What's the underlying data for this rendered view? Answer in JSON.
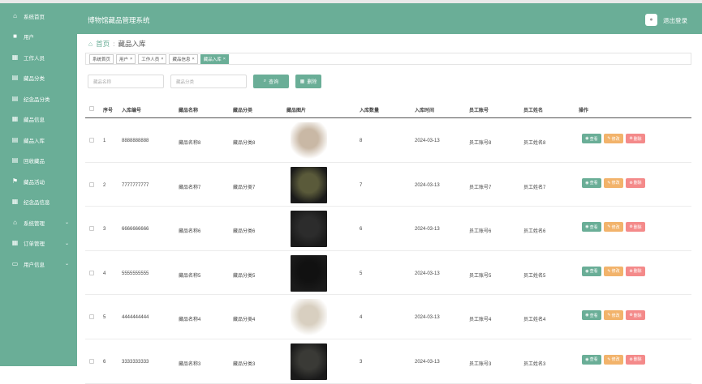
{
  "app": {
    "title": "博物馆藏品管理系统",
    "logout_label": "退出登录"
  },
  "sidebar": {
    "items": [
      {
        "label": "系统首页",
        "icon": "home-icon",
        "has_arrow": false
      },
      {
        "label": "用户",
        "icon": "user-square-icon",
        "has_arrow": false
      },
      {
        "label": "工作人员",
        "icon": "grid-icon",
        "has_arrow": false
      },
      {
        "label": "藏品分类",
        "icon": "clipboard-icon",
        "has_arrow": false
      },
      {
        "label": "纪念品分类",
        "icon": "clipboard-icon",
        "has_arrow": false
      },
      {
        "label": "藏品信息",
        "icon": "grid-icon",
        "has_arrow": false
      },
      {
        "label": "藏品入库",
        "icon": "clipboard-icon",
        "has_arrow": false
      },
      {
        "label": "回收藏品",
        "icon": "clipboard-icon",
        "has_arrow": false
      },
      {
        "label": "藏品活动",
        "icon": "flag-icon",
        "has_arrow": false
      },
      {
        "label": "纪念品信息",
        "icon": "table-icon",
        "has_arrow": false
      },
      {
        "label": "系统管理",
        "icon": "bank-icon",
        "has_arrow": true
      },
      {
        "label": "订单管理",
        "icon": "grid-icon",
        "has_arrow": true
      },
      {
        "label": "用户信息",
        "icon": "card-icon",
        "has_arrow": true
      }
    ]
  },
  "breadcrumb": {
    "home": "首页",
    "sep": ":",
    "current": "藏品入库"
  },
  "tabs": [
    {
      "label": "系统首页",
      "closable": false,
      "active": false
    },
    {
      "label": "用户",
      "closable": true,
      "active": false
    },
    {
      "label": "工作人员",
      "closable": true,
      "active": false
    },
    {
      "label": "藏品信息",
      "closable": true,
      "active": false
    },
    {
      "label": "藏品入库",
      "closable": true,
      "active": true
    }
  ],
  "search": {
    "name_placeholder": "藏品名称",
    "category_placeholder": "藏品分类",
    "query_label": "查询",
    "delete_label": "删除"
  },
  "table": {
    "headers": [
      "序号",
      "入库编号",
      "藏品名称",
      "藏品分类",
      "藏品图片",
      "入库数量",
      "入库时间",
      "员工账号",
      "员工姓名",
      "操作"
    ],
    "actions": {
      "view": "查看",
      "edit": "修改",
      "delete": "删除"
    },
    "rows": [
      {
        "index": "1",
        "code": "8888888888",
        "name": "藏品名称8",
        "category": "藏品分类8",
        "qty": "8",
        "date": "2024-03-13",
        "account": "员工账号8",
        "staff": "员工姓名8",
        "img_color": "#c9b8a5"
      },
      {
        "index": "2",
        "code": "7777777777",
        "name": "藏品名称7",
        "category": "藏品分类7",
        "qty": "7",
        "date": "2024-03-13",
        "account": "员工账号7",
        "staff": "员工姓名7",
        "img_color": "#5a5a3a"
      },
      {
        "index": "3",
        "code": "6666666666",
        "name": "藏品名称6",
        "category": "藏品分类6",
        "qty": "6",
        "date": "2024-03-13",
        "account": "员工账号6",
        "staff": "员工姓名6",
        "img_color": "#2c2c2c"
      },
      {
        "index": "4",
        "code": "5555555555",
        "name": "藏品名称5",
        "category": "藏品分类5",
        "qty": "5",
        "date": "2024-03-13",
        "account": "员工账号5",
        "staff": "员工姓名5",
        "img_color": "#111111"
      },
      {
        "index": "5",
        "code": "4444444444",
        "name": "藏品名称4",
        "category": "藏品分类4",
        "qty": "4",
        "date": "2024-03-13",
        "account": "员工账号4",
        "staff": "员工姓名4",
        "img_color": "#d8cfc0"
      },
      {
        "index": "6",
        "code": "3333333333",
        "name": "藏品名称3",
        "category": "藏品分类3",
        "qty": "3",
        "date": "2024-03-13",
        "account": "员工账号3",
        "staff": "员工姓名3",
        "img_color": "#3a3a36"
      }
    ]
  },
  "colors": {
    "accent": "#6aae97",
    "edit": "#f2b36b",
    "delete": "#f48a8a"
  }
}
